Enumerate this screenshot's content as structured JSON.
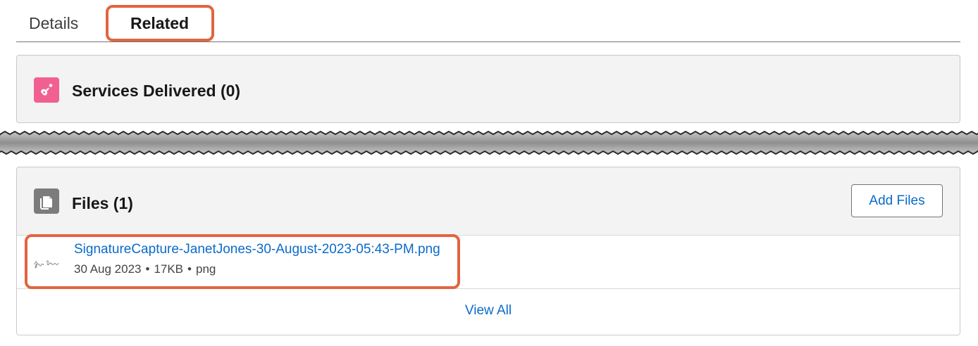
{
  "tabs": [
    {
      "label": "Details",
      "active": false
    },
    {
      "label": "Related",
      "active": true
    }
  ],
  "services_card": {
    "title": "Services Delivered (0)",
    "icon": "guitar-icon",
    "icon_color": "#f06191"
  },
  "files_card": {
    "title": "Files (1)",
    "icon": "document-copy-icon",
    "icon_color": "#7c7c7c",
    "add_button_label": "Add Files",
    "files": [
      {
        "name": "SignatureCapture-JanetJones-30-August-2023-05:43-PM.png",
        "date": "30 Aug 2023",
        "size": "17KB",
        "type": "png",
        "thumbnail": "signature-thumbnail"
      }
    ],
    "view_all_label": "View All"
  },
  "colors": {
    "link": "#0b6bc9",
    "highlight": "#e1653f",
    "card_bg": "#f3f3f3"
  }
}
